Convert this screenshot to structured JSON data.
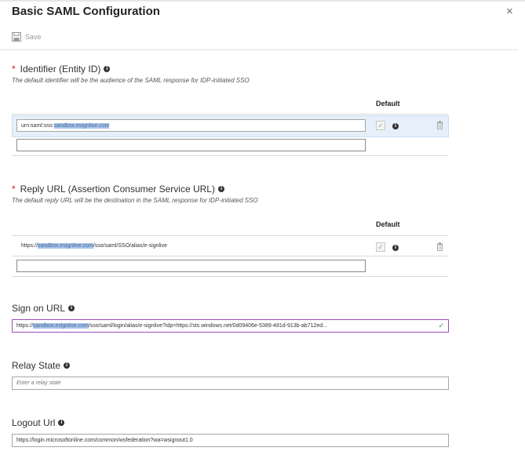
{
  "header": {
    "title": "Basic SAML Configuration",
    "close_label": "×"
  },
  "toolbar": {
    "save_label": "Save"
  },
  "identifier": {
    "label": "Identifier (Entity ID)",
    "description": "The default identifier will be the audience of the SAML response for IDP-initiated SSO",
    "default_header": "Default",
    "value_prefix": "urn:saml:sso:",
    "value_highlight": "sandbox.esignlive.com",
    "new_value": ""
  },
  "reply": {
    "label": "Reply URL (Assertion Consumer Service URL)",
    "description": "The default reply URL will be the destination in the SAML response for IDP-initiated SSO",
    "default_header": "Default",
    "value_prefix": "https://",
    "value_highlight": "sandbox.esignlive.com",
    "value_suffix": "/sso/saml/SSO/alias/e-signlive",
    "new_value": ""
  },
  "signon": {
    "label": "Sign on URL",
    "value_prefix": "https://",
    "value_highlight": "sandbox.esignlive.com",
    "value_suffix": "/sso/saml/login/alias/e-signlive?idp=https://sts.windows.net/0d09406e-5389-481d-913b-ab712ed...",
    "valid_mark": "✓"
  },
  "relay": {
    "label": "Relay State",
    "placeholder": "Enter a relay state",
    "value": ""
  },
  "logout": {
    "label": "Logout Url",
    "value": "https://login.microsoftonline.com/common/wsfederation?wa=wsignout1.0"
  },
  "colors": {
    "required": "#e00b1c",
    "selection": "#e6f0fa",
    "highlight": "#a9c6ea",
    "focus_border": "#9b4dba",
    "valid": "#3c9a3c"
  }
}
